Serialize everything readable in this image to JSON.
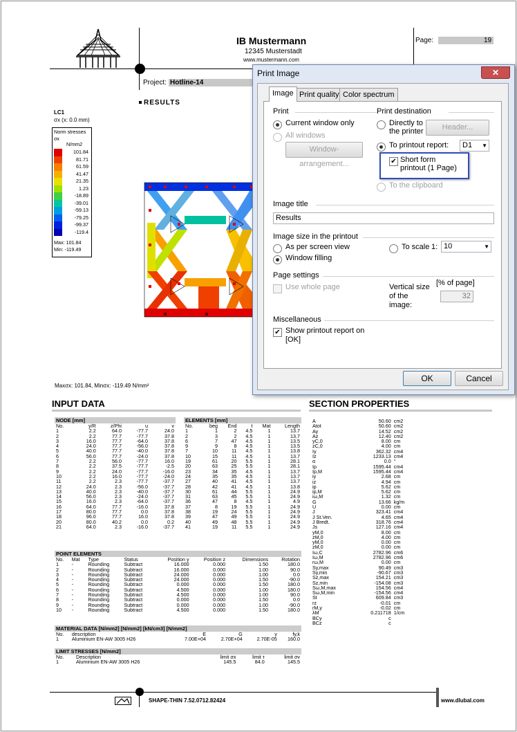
{
  "header": {
    "company": "IB Mustermann",
    "city": "12345 Musterstadt",
    "web": "www.mustermann.com",
    "page_label": "Page:",
    "page_num": "19",
    "project_label": "Project:",
    "project": "Hotline-14"
  },
  "results": {
    "title": "RESULTS",
    "lc": "LC1",
    "sigma": "σx (x: 0.0 mm)",
    "legend_title": "Norm stresses",
    "legend_sym": "σx",
    "legend_unit": "N/mm2",
    "legend_values": [
      "101.84",
      "81.71",
      "61.59",
      "41.47",
      "21.35",
      "1.23",
      "-18.89",
      "-39.01",
      "-59.13",
      "-79.25",
      "-99.37",
      "-119.4"
    ],
    "legend_colors": [
      "#e00000",
      "#f04000",
      "#f88000",
      "#f8b000",
      "#e8e000",
      "#a0e000",
      "#40d040",
      "#00c8a0",
      "#00a0e0",
      "#0060f0",
      "#0020e0",
      "#0000b0"
    ],
    "max": "Max: 101.84",
    "min": "Min: -119.49",
    "footer": "Maxσx: 101.84, Minσx: -119.49 N/mm²"
  },
  "input_title": "INPUT DATA",
  "section_title": "SECTION PROPERTIES",
  "node_header": "NODE [mm]",
  "node_cols": [
    "No.",
    "y/R",
    "z/Phi",
    "u",
    "v"
  ],
  "nodes": [
    [
      "1",
      "2.2",
      "64.0",
      "-77.7",
      "24.0"
    ],
    [
      "2",
      "2.2",
      "77.7",
      "-77.7",
      "37.8"
    ],
    [
      "3",
      "16.0",
      "77.7",
      "-64.0",
      "37.8"
    ],
    [
      "4",
      "24.0",
      "77.7",
      "-56.0",
      "37.8"
    ],
    [
      "5",
      "40.0",
      "77.7",
      "-40.0",
      "37.8"
    ],
    [
      "6",
      "56.0",
      "77.7",
      "-24.0",
      "37.8"
    ],
    [
      "7",
      "2.2",
      "56.0",
      "-77.7",
      "16.0"
    ],
    [
      "8",
      "2.2",
      "37.5",
      "-77.7",
      "-2.5"
    ],
    [
      "9",
      "2.2",
      "24.0",
      "-77.7",
      "-16.0"
    ],
    [
      "10",
      "2.2",
      "16.0",
      "-77.7",
      "-24.0"
    ],
    [
      "11",
      "2.2",
      "2.3",
      "-77.7",
      "-37.7"
    ],
    [
      "12",
      "24.0",
      "2.3",
      "-56.0",
      "-37.7"
    ],
    [
      "13",
      "40.0",
      "2.3",
      "-40.0",
      "-37.7"
    ],
    [
      "14",
      "56.0",
      "2.3",
      "-24.0",
      "-37.7"
    ],
    [
      "15",
      "16.0",
      "2.3",
      "-64.0",
      "-37.7"
    ],
    [
      "16",
      "64.0",
      "77.7",
      "-16.0",
      "37.8"
    ],
    [
      "17",
      "80.0",
      "77.7",
      "0.0",
      "37.8"
    ],
    [
      "18",
      "96.0",
      "77.7",
      "16.0",
      "37.8"
    ],
    [
      "20",
      "80.0",
      "40.2",
      "0.0",
      "0.2"
    ],
    [
      "21",
      "64.0",
      "2.3",
      "-16.0",
      "-37.7"
    ]
  ],
  "elem_header": "ELEMENTS [mm]",
  "elem_cols": [
    "No.",
    "beg",
    "End",
    "t",
    "Mat",
    "Length"
  ],
  "elements": [
    [
      "1",
      "1",
      "2",
      "4.5",
      "1",
      "13.7"
    ],
    [
      "2",
      "3",
      "2",
      "4.5",
      "1",
      "13.7"
    ],
    [
      "6",
      "7",
      "47",
      "4.5",
      "1",
      "13.5"
    ],
    [
      "9",
      "9",
      "8",
      "4.5",
      "1",
      "13.5"
    ],
    [
      "7",
      "10",
      "11",
      "4.5",
      "1",
      "13.8"
    ],
    [
      "10",
      "15",
      "11",
      "4.5",
      "1",
      "13.7"
    ],
    [
      "19",
      "61",
      "20",
      "5.5",
      "1",
      "28.1"
    ],
    [
      "20",
      "63",
      "25",
      "5.5",
      "1",
      "28.1"
    ],
    [
      "23",
      "34",
      "35",
      "4.5",
      "1",
      "13.7"
    ],
    [
      "24",
      "35",
      "35",
      "4.5",
      "1",
      "13.7"
    ],
    [
      "27",
      "40",
      "41",
      "4.5",
      "1",
      "13.7"
    ],
    [
      "28",
      "42",
      "41",
      "4.5",
      "1",
      "13.8"
    ],
    [
      "30",
      "61",
      "44",
      "5.5",
      "1",
      "24.9"
    ],
    [
      "31",
      "63",
      "45",
      "5.5",
      "1",
      "24.9"
    ],
    [
      "36",
      "47",
      "8",
      "4.5",
      "1",
      "4.9"
    ],
    [
      "37",
      "8",
      "19",
      "5.5",
      "1",
      "24.9"
    ],
    [
      "38",
      "19",
      "24",
      "5.5",
      "1",
      "24.9"
    ],
    [
      "39",
      "47",
      "49",
      "5.5",
      "1",
      "24.9"
    ],
    [
      "40",
      "49",
      "48",
      "5.5",
      "1",
      "24.9"
    ],
    [
      "41",
      "19",
      "11",
      "5.5",
      "1",
      "24.9"
    ]
  ],
  "point_header": "POINT ELEMENTS",
  "point_cols": [
    "No.",
    "Mat",
    "Type",
    "Status",
    "Position y",
    "Position z",
    "Dimensions",
    "Rotation"
  ],
  "points": [
    [
      "1",
      "-",
      "Rounding",
      "Subtract",
      "16.000",
      "0.000",
      "1.50",
      "180.0"
    ],
    [
      "2",
      "-",
      "Rounding",
      "Subtract",
      "16.000",
      "0.000",
      "1.00",
      "90.0"
    ],
    [
      "3",
      "-",
      "Rounding",
      "Subtract",
      "24.000",
      "0.000",
      "1.00",
      "0.0"
    ],
    [
      "4",
      "-",
      "Rounding",
      "Subtract",
      "24.000",
      "0.000",
      "1.50",
      "-90.0"
    ],
    [
      "5",
      "-",
      "Rounding",
      "Subtract",
      "0.000",
      "0.000",
      "1.50",
      "180.0"
    ],
    [
      "6",
      "-",
      "Rounding",
      "Subtract",
      "4.500",
      "0.000",
      "1.00",
      "180.0"
    ],
    [
      "7",
      "-",
      "Rounding",
      "Subtract",
      "4.500",
      "0.000",
      "1.00",
      "90.0"
    ],
    [
      "8",
      "-",
      "Rounding",
      "Subtract",
      "0.000",
      "0.000",
      "1.50",
      "0.0"
    ],
    [
      "9",
      "-",
      "Rounding",
      "Subtract",
      "0.000",
      "0.000",
      "1.00",
      "-90.0"
    ],
    [
      "10",
      "-",
      "Rounding",
      "Subtract",
      "4.500",
      "0.000",
      "1.50",
      "180.0"
    ]
  ],
  "mat_header": "MATERIAL DATA [N/mm2] [N/mm2] [kN/cm3] [N/mm2]",
  "mat_cols": [
    "No.",
    "description",
    "E",
    "G",
    "γ",
    "fy,k"
  ],
  "mat_row": [
    "1",
    "Aluminium EN-AW 3005 H26",
    "7.00E+04",
    "2.70E+04",
    "2.70E-05",
    "160.0"
  ],
  "lim_header": "LIMIT STRESSES [N/mm2]",
  "lim_cols": [
    "No.",
    "Description",
    "limit σx",
    "limit τ",
    "limit σv"
  ],
  "lim_row": [
    "1",
    "Aluminium EN-AW 3005 H26",
    "145.5",
    "84.0",
    "145.5"
  ],
  "section_props": [
    [
      "A",
      "50.60",
      "cm2"
    ],
    [
      "Atot",
      "50.60",
      "cm2"
    ],
    [
      "Ay",
      "14.52",
      "cm2"
    ],
    [
      "Az",
      "12.40",
      "cm2"
    ],
    [
      "yC,0",
      "8.00",
      "cm"
    ],
    [
      "zC,0",
      "4.00",
      "cm"
    ],
    [
      "Iy",
      "362.32",
      "cm4"
    ],
    [
      "Iz",
      "1233.13",
      "cm4"
    ],
    [
      "α",
      "0.0",
      "°"
    ],
    [
      "Ip",
      "1595.44",
      "cm4"
    ],
    [
      "Ip,M",
      "1595.44",
      "cm4"
    ],
    [
      "iy",
      "2.68",
      "cm"
    ],
    [
      "iz",
      "4.94",
      "cm"
    ],
    [
      "ip",
      "5.62",
      "cm"
    ],
    [
      "ip,M",
      "5.62",
      "cm"
    ],
    [
      "iω,M",
      "1.32",
      "cm"
    ],
    [
      "G",
      "13.66",
      "kg/m"
    ],
    [
      "U",
      "0.00",
      "cm"
    ],
    [
      "J",
      "323.41",
      "cm4"
    ],
    [
      "J St.Ven.",
      "4.65",
      "cm4"
    ],
    [
      "J Bredt.",
      "318.76",
      "cm4"
    ],
    [
      "Js",
      "127.16",
      "cm4"
    ],
    [
      "yM,0",
      "8.00",
      "cm"
    ],
    [
      "zM,0",
      "4.00",
      "cm"
    ],
    [
      "yM,0",
      "0.00",
      "cm"
    ],
    [
      "zM,0",
      "0.00",
      "cm"
    ],
    [
      "Iω,C",
      "2782.96",
      "cm6"
    ],
    [
      "Iω,M",
      "2782.96",
      "cm6"
    ],
    [
      "rω,M",
      "0.00",
      "cm"
    ],
    [
      "Sy,max",
      "90.49",
      "cm3"
    ],
    [
      "Sy,min",
      "-90.67",
      "cm3"
    ],
    [
      "Sz,max",
      "154.21",
      "cm3"
    ],
    [
      "Sz,min",
      "-154.08",
      "cm3"
    ],
    [
      "Sω,M,max",
      "154.56",
      "cm4"
    ],
    [
      "Sω,M,min",
      "-154.56",
      "cm4"
    ],
    [
      "St",
      "609.84",
      "cm3"
    ],
    [
      "rz",
      "-0.01",
      "cm"
    ],
    [
      "rM,y",
      "-0.02",
      "cm"
    ],
    [
      "λM",
      "0.211718",
      "1/cm"
    ],
    [
      "BCy",
      "c",
      ""
    ],
    [
      "BCz",
      "c",
      ""
    ]
  ],
  "footer": {
    "program": "SHAPE-THIN 7.52.0712.82424",
    "web": "www.dlubal.com"
  },
  "dialog": {
    "title": "Print Image",
    "close": "✕",
    "tabs": [
      "Image",
      "Print quality",
      "Color spectrum"
    ],
    "print_group": "Print",
    "opt_current": "Current window only",
    "opt_all": "All windows",
    "btn_window": "Window-arrangement...",
    "dest_group": "Print destination",
    "opt_direct": "Directly to the printer",
    "btn_header": "Header...",
    "opt_report": "To printout report:",
    "report_val": "D1",
    "chk_short": "Short form printout (1 Page)",
    "opt_clip": "To the clipboard",
    "title_group": "Image title",
    "title_val": "Results",
    "size_group": "Image size in the printout",
    "opt_screen": "As per screen view",
    "opt_fill": "Window filling",
    "opt_scale": "To scale",
    "scale_prefix": "1:",
    "scale_val": "10",
    "page_group": "Page settings",
    "chk_whole": "Use whole page",
    "vert_label": "Vertical size of the image:",
    "vert_unit": "[% of page]",
    "vert_val": "32",
    "misc_group": "Miscellaneous",
    "chk_show": "Show printout report on",
    "chk_show2": "[OK]",
    "ok": "OK",
    "cancel": "Cancel"
  }
}
